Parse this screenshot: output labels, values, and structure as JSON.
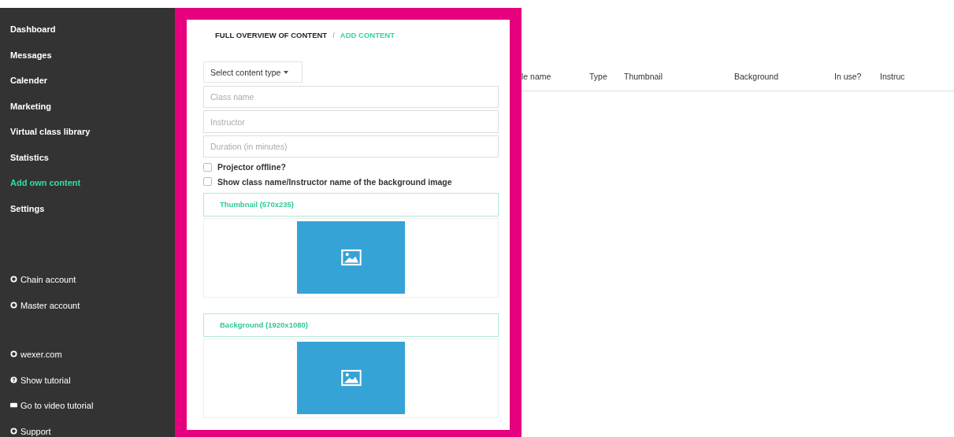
{
  "sidebar": {
    "items": [
      {
        "label": "Dashboard",
        "selected": false
      },
      {
        "label": "Messages",
        "selected": false
      },
      {
        "label": "Calender",
        "selected": false
      },
      {
        "label": "Marketing",
        "selected": false
      },
      {
        "label": "Virtual class library",
        "selected": false
      },
      {
        "label": "Statistics",
        "selected": false
      },
      {
        "label": "Add own content",
        "selected": true
      },
      {
        "label": "Settings",
        "selected": false
      }
    ],
    "accounts": [
      {
        "label": "Chain account"
      },
      {
        "label": "Master account"
      }
    ],
    "links": [
      {
        "label": "wexer.com",
        "kind": "circle"
      },
      {
        "label": "Show tutorial",
        "kind": "help"
      },
      {
        "label": "Go to video tutorial",
        "kind": "video"
      },
      {
        "label": "Support",
        "kind": "circle"
      }
    ]
  },
  "breadcrumb": [
    {
      "label": "FULL OVERVIEW OF CONTENT",
      "selected": false
    },
    {
      "label": "ADD CONTENT",
      "selected": true
    }
  ],
  "breadcrumb_separator": "/",
  "form": {
    "content_type": "Select content type",
    "fields": [
      {
        "placeholder": "Class name"
      },
      {
        "placeholder": "Instructor"
      },
      {
        "placeholder": "Duration (in minutes)"
      }
    ],
    "checkboxes": [
      {
        "label": "Projector offline?",
        "checked": false
      },
      {
        "label": "Show class name/Instructor name of the background image",
        "checked": false
      }
    ],
    "uploads": [
      {
        "label": "Thumbnail (570x235)"
      },
      {
        "label": "Background (1920x1080)"
      }
    ]
  },
  "table": {
    "columns": [
      "le name",
      "Type",
      "Thumbnail",
      "Background",
      "In use?",
      "Instruc"
    ]
  }
}
